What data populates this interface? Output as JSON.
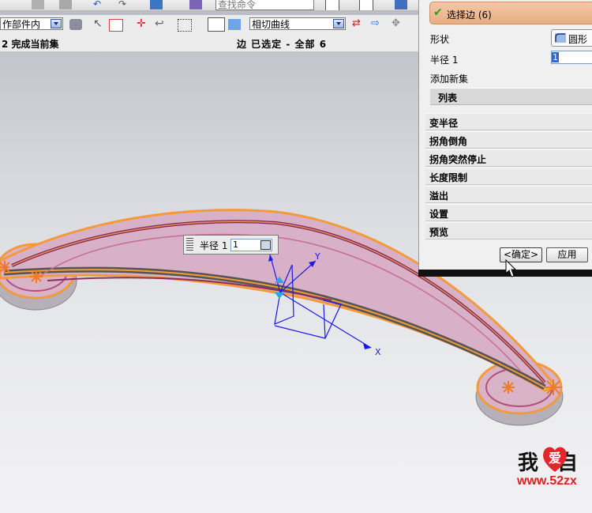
{
  "toolbar": {
    "search_placeholder": "查找命令",
    "scope_select": "作部件内",
    "curve_rule_select": "相切曲线"
  },
  "selection_bar": {
    "left_text": "2 完成当前集",
    "right_text": "边 已选定 - 全部 6"
  },
  "dialog": {
    "select_edge_label": "选择边 (6)",
    "shape_label": "形状",
    "shape_value": "圆形",
    "radius_label": "半径 1",
    "radius_value": "1",
    "add_new_set_label": "添加新集",
    "list_label": "列表",
    "sections": [
      "变半径",
      "拐角倒角",
      "拐角突然停止",
      "长度限制",
      "溢出",
      "设置",
      "预览"
    ],
    "ok_label": "<确定>",
    "apply_label": "应用"
  },
  "radius_popup": {
    "label": "半径 1",
    "value": "1"
  },
  "axes": {
    "x_label": "X",
    "y_label": "Y"
  },
  "watermark": {
    "text": "我爱自",
    "url": "www.52zx"
  },
  "colors": {
    "viewport_top": "#b9bcc3",
    "part_fill": "#dcb0c6",
    "edge_highlight": "#f39a3c",
    "axis_blue": "#1a1ae6",
    "header_accent": "#f3c8a4"
  }
}
